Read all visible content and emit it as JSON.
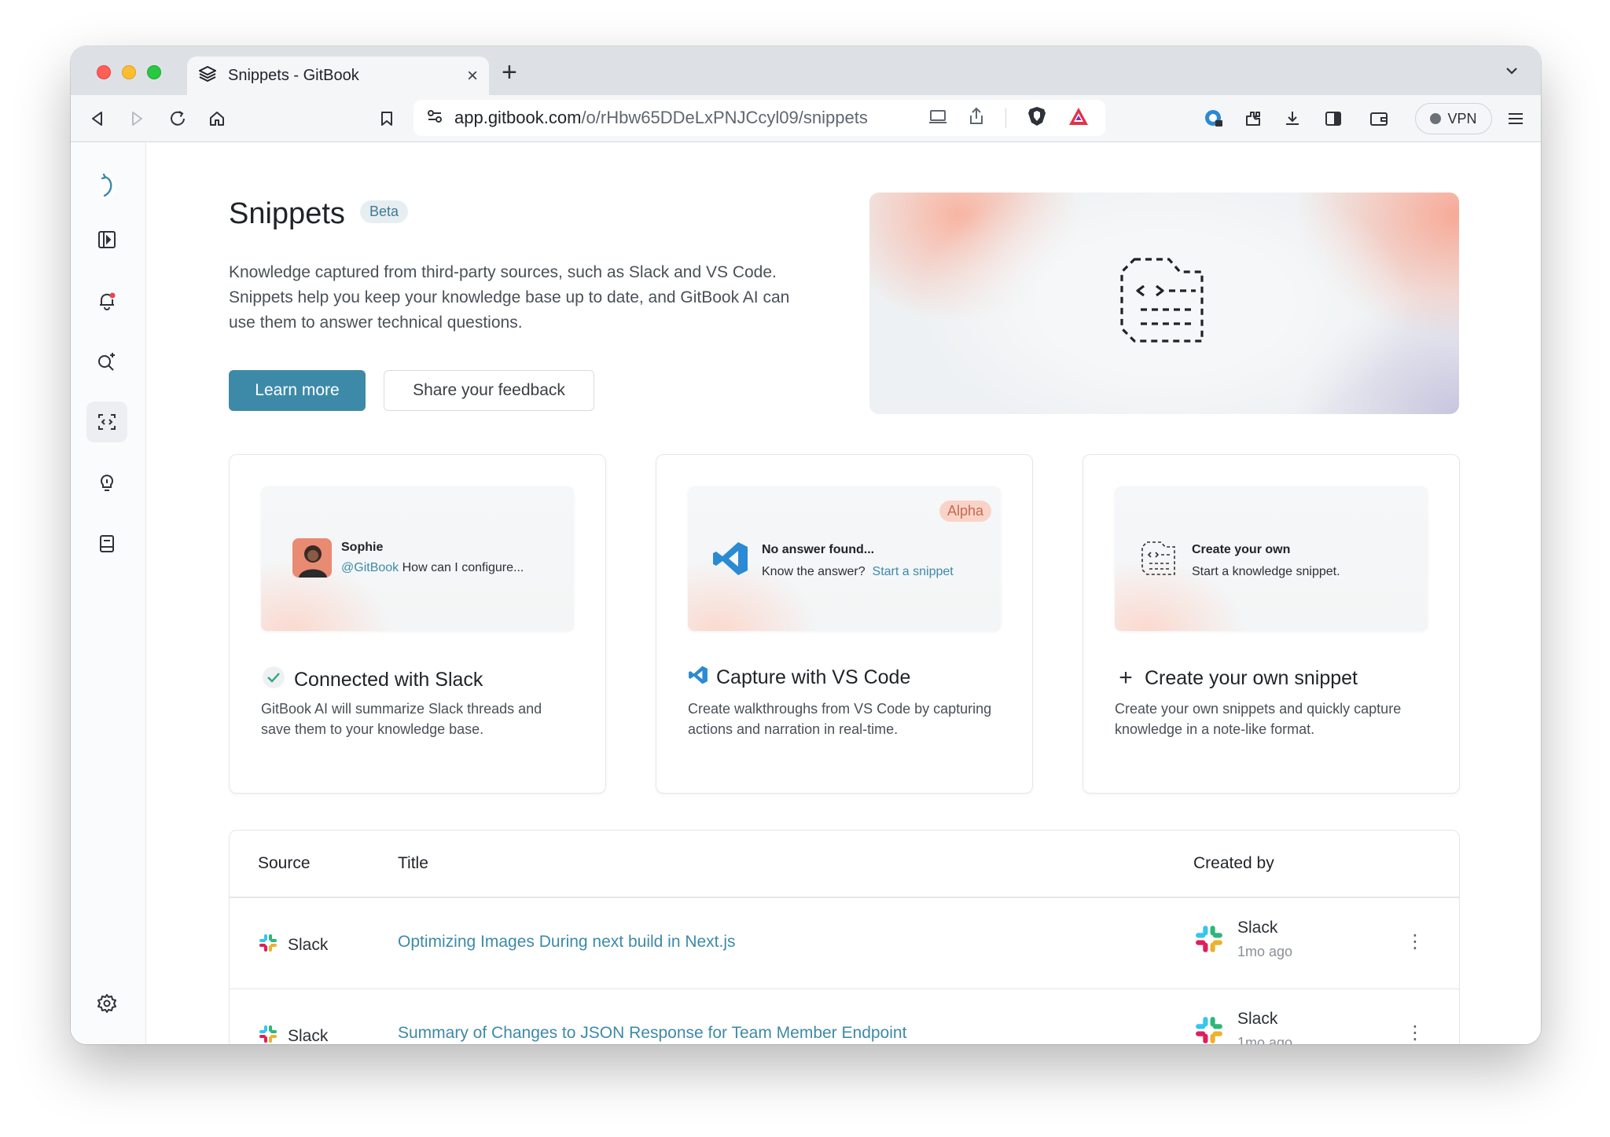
{
  "browser": {
    "tab_title": "Snippets - GitBook",
    "url_host": "app.gitbook.com",
    "url_path": "/o/rHbw65DDeLxPNJCcyl09/snippets",
    "vpn_label": "VPN",
    "new_tab_glyph": "+",
    "close_glyph": "×"
  },
  "hero": {
    "title": "Snippets",
    "badge": "Beta",
    "description": "Knowledge captured from third-party sources, such as Slack and VS Code. Snippets help you keep your knowledge base up to date, and GitBook AI can use them to answer technical questions.",
    "primary_button": "Learn more",
    "secondary_button": "Share your feedback"
  },
  "cards": [
    {
      "preview": {
        "name": "Sophie",
        "mention": "@GitBook",
        "message": "How can I configure..."
      },
      "title": "Connected with Slack",
      "description": "GitBook AI will summarize Slack threads and save them to your knowledge base."
    },
    {
      "preview": {
        "badge": "Alpha",
        "heading": "No answer found...",
        "prompt": "Know the answer?",
        "link": "Start a snippet"
      },
      "title": "Capture with VS Code",
      "description": "Create walkthroughs from VS Code by capturing actions and narration in real-time."
    },
    {
      "preview": {
        "heading": "Create your own",
        "subtext": "Start a knowledge snippet."
      },
      "title": "Create your own snippet",
      "icon_glyph": "+",
      "description": "Create your own snippets and quickly capture knowledge in a note-like format."
    }
  ],
  "table": {
    "columns": {
      "source": "Source",
      "title": "Title",
      "created_by": "Created by"
    },
    "rows": [
      {
        "source": "Slack",
        "title": "Optimizing Images During next build in Next.js",
        "creator": "Slack",
        "time": "1mo ago"
      },
      {
        "source": "Slack",
        "title": "Summary of Changes to JSON Response for Team Member Endpoint",
        "creator": "Slack",
        "time": "1mo ago"
      }
    ],
    "kebab_glyph": "⋮"
  },
  "colors": {
    "accent": "#3d8aa8",
    "slack_red": "#e01e5a",
    "slack_green": "#2eb67d",
    "slack_yellow": "#ecb22e",
    "slack_blue": "#36c5f0",
    "vscode_blue": "#2a8ad4"
  },
  "icons": {
    "sidebar": [
      "gitbook-logo-icon",
      "sidebar-toggle-icon",
      "notifications-bell-icon",
      "search-ai-icon",
      "snippets-icon",
      "insights-bulb-icon",
      "docs-book-icon",
      "settings-gear-icon"
    ]
  }
}
